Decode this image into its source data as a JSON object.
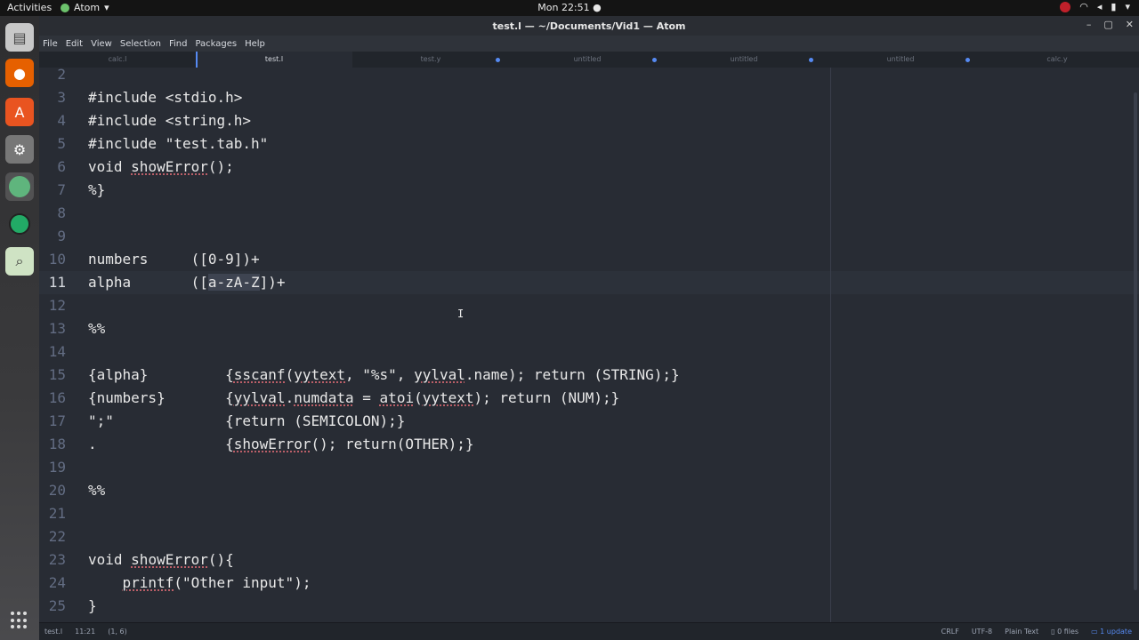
{
  "system": {
    "activities": "Activities",
    "app_name": "Atom",
    "clock": "Mon 22:51 ●"
  },
  "window": {
    "title": "test.l — ~/Documents/Vid1 — Atom",
    "minimize": "–",
    "maximize": "▢",
    "close": "✕"
  },
  "menu": [
    "File",
    "Edit",
    "View",
    "Selection",
    "Find",
    "Packages",
    "Help"
  ],
  "tabs": [
    {
      "label": "calc.l",
      "modified": false,
      "active": false
    },
    {
      "label": "test.l",
      "modified": false,
      "active": true
    },
    {
      "label": "test.y",
      "modified": true,
      "active": false
    },
    {
      "label": "untitled",
      "modified": true,
      "active": false
    },
    {
      "label": "untitled",
      "modified": true,
      "active": false
    },
    {
      "label": "untitled",
      "modified": true,
      "active": false
    },
    {
      "label": "calc.y",
      "modified": false,
      "active": false
    }
  ],
  "editor": {
    "current_line": 11,
    "lines": [
      {
        "n": "2",
        "text": ""
      },
      {
        "n": "3",
        "text": "#include <stdio.h>"
      },
      {
        "n": "4",
        "text": "#include <string.h>"
      },
      {
        "n": "5",
        "text": "#include \"test.tab.h\""
      },
      {
        "n": "6",
        "text": "void showError();"
      },
      {
        "n": "7",
        "text": "%}"
      },
      {
        "n": "8",
        "text": ""
      },
      {
        "n": "9",
        "text": ""
      },
      {
        "n": "10",
        "text": "numbers     ([0-9])+"
      },
      {
        "n": "11",
        "text": "alpha       ([a-zA-Z])+"
      },
      {
        "n": "12",
        "text": ""
      },
      {
        "n": "13",
        "text": "%%"
      },
      {
        "n": "14",
        "text": ""
      },
      {
        "n": "15",
        "text": "{alpha}         {sscanf(yytext, \"%s\", yylval.name); return (STRING);}"
      },
      {
        "n": "16",
        "text": "{numbers}       {yylval.numdata = atoi(yytext); return (NUM);}"
      },
      {
        "n": "17",
        "text": "\";\"             {return (SEMICOLON);}"
      },
      {
        "n": "18",
        "text": ".               {showError(); return(OTHER);}"
      },
      {
        "n": "19",
        "text": ""
      },
      {
        "n": "20",
        "text": "%%"
      },
      {
        "n": "21",
        "text": ""
      },
      {
        "n": "22",
        "text": ""
      },
      {
        "n": "23",
        "text": "void showError(){"
      },
      {
        "n": "24",
        "text": "    printf(\"Other input\");"
      },
      {
        "n": "25",
        "text": "}"
      }
    ]
  },
  "status": {
    "file": "test.l",
    "cursor": "11:21",
    "selection": "(1, 6)",
    "line_ending": "CRLF",
    "encoding": "UTF-8",
    "grammar": "Plain Text",
    "files": "0 files",
    "update": "1 update"
  },
  "colors": {
    "accent": "#568af2",
    "background": "#282c34",
    "text": "#e8e8e8"
  }
}
